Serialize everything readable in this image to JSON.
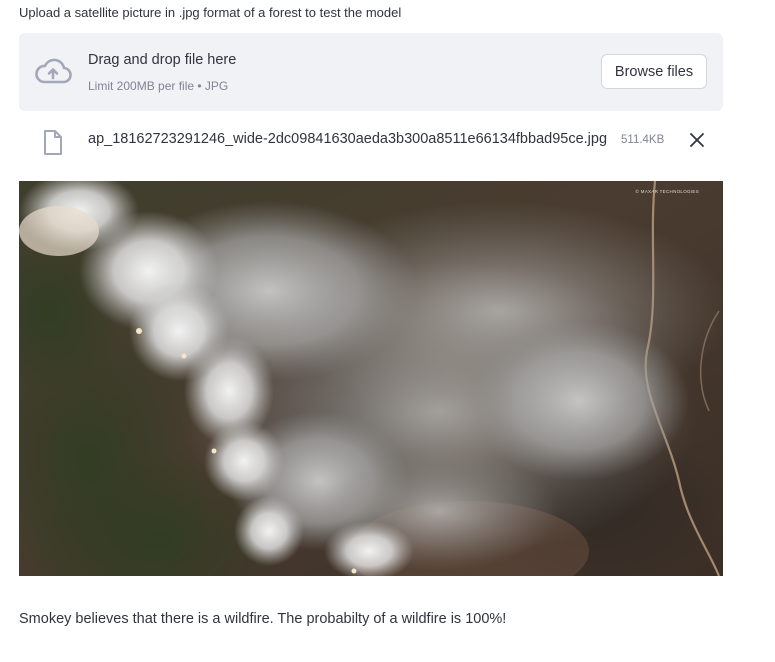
{
  "upload": {
    "label": "Upload a satellite picture in .jpg format of a forest to test the model",
    "dropzone_title": "Drag and drop file here",
    "dropzone_subtitle": "Limit 200MB per file • JPG",
    "browse_label": "Browse files"
  },
  "file": {
    "name": "ap_18162723291246_wide-2dc09841630aeda3b300a8511e66134fbbad95ce.jpg",
    "size": "511.4KB"
  },
  "image": {
    "watermark": "© MAXAR TECHNOLOGIES"
  },
  "result": {
    "text": "Smokey believes that there is a wildfire. The probabilty of a wildfire is 100%!"
  },
  "colors": {
    "dropzone_bg": "#f0f2f6",
    "text": "#31333f",
    "muted": "#808495",
    "icon": "#a3a8b8"
  }
}
